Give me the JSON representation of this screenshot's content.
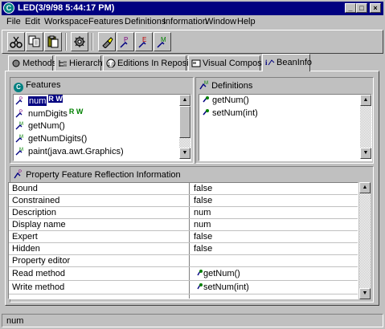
{
  "window": {
    "title": "LED(3/9/98 5:44:17 PM)",
    "app_icon_letter": "C",
    "controls": {
      "minimize": "_",
      "maximize": "□",
      "close": "×"
    }
  },
  "menu": [
    "File",
    "Edit",
    "Workspace",
    "Features",
    "Definitions",
    "Information",
    "Window",
    "Help"
  ],
  "toolbar": {
    "buttons": [
      "cut-icon",
      "copy-icon",
      "paste-icon",
      "run-icon",
      "flashlight-icon",
      "add-method-icon",
      "add-field-icon",
      "add-method-alt-icon"
    ]
  },
  "tabs": [
    {
      "label": "Methods",
      "icon": "methods-icon"
    },
    {
      "label": "Hierarchy",
      "icon": "hierarchy-icon"
    },
    {
      "label": "Editions In Repository",
      "icon": "editions-icon"
    },
    {
      "label": "Visual Composition",
      "icon": "visual-composition-icon"
    },
    {
      "label": "BeanInfo",
      "icon": "beaninfo-icon",
      "active": true
    }
  ],
  "features": {
    "header": "Features",
    "items": [
      {
        "label": "num",
        "badge": "R W",
        "type": "property",
        "selected": true
      },
      {
        "label": "numDigits",
        "badge": "R W",
        "type": "property"
      },
      {
        "label": "getNum()",
        "type": "method"
      },
      {
        "label": "getNumDigits()",
        "type": "method"
      },
      {
        "label": "paint(java.awt.Graphics)",
        "type": "method"
      }
    ]
  },
  "definitions": {
    "header": "Definitions",
    "items": [
      {
        "label": "getNum()"
      },
      {
        "label": "setNum(int)"
      }
    ]
  },
  "property_info": {
    "header": "Property Feature Reflection Information",
    "rows": [
      {
        "name": "Bound",
        "value": "false"
      },
      {
        "name": "Constrained",
        "value": "false"
      },
      {
        "name": "Description",
        "value": "num"
      },
      {
        "name": "Display name",
        "value": "num"
      },
      {
        "name": "Expert",
        "value": "false"
      },
      {
        "name": "Hidden",
        "value": "false"
      },
      {
        "name": "Property editor",
        "value": ""
      },
      {
        "name": "Read method",
        "value": "getNum()",
        "method": true
      },
      {
        "name": "Write method",
        "value": "setNum(int)",
        "method": true
      }
    ]
  },
  "status": {
    "text": "num"
  },
  "colors": {
    "titlebar": "#000080",
    "face": "#c0c0c0",
    "selection": "#000080",
    "rw_badge": "#008000"
  }
}
